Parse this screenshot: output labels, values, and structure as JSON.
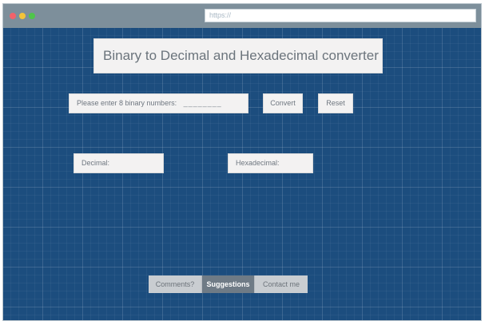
{
  "browser": {
    "url": "https://"
  },
  "page": {
    "title": "Binary to Decimal and Hexadecimal converter",
    "input": {
      "label": "Please enter 8 binary numbers:",
      "mask": "________"
    },
    "buttons": {
      "convert": "Convert",
      "reset": "Reset"
    },
    "outputs": {
      "decimal_label": "Decimal:",
      "hex_label": "Hexadecimal:"
    },
    "footer": {
      "items": [
        {
          "label": "Comments?",
          "active": false
        },
        {
          "label": "Suggestions",
          "active": true
        },
        {
          "label": "Contact me",
          "active": false
        }
      ]
    }
  },
  "colors": {
    "background": "#1c4d7e",
    "titlebar": "#7d8f9b",
    "panel": "#f3f2f2",
    "footer_active": "#6f7b86"
  }
}
